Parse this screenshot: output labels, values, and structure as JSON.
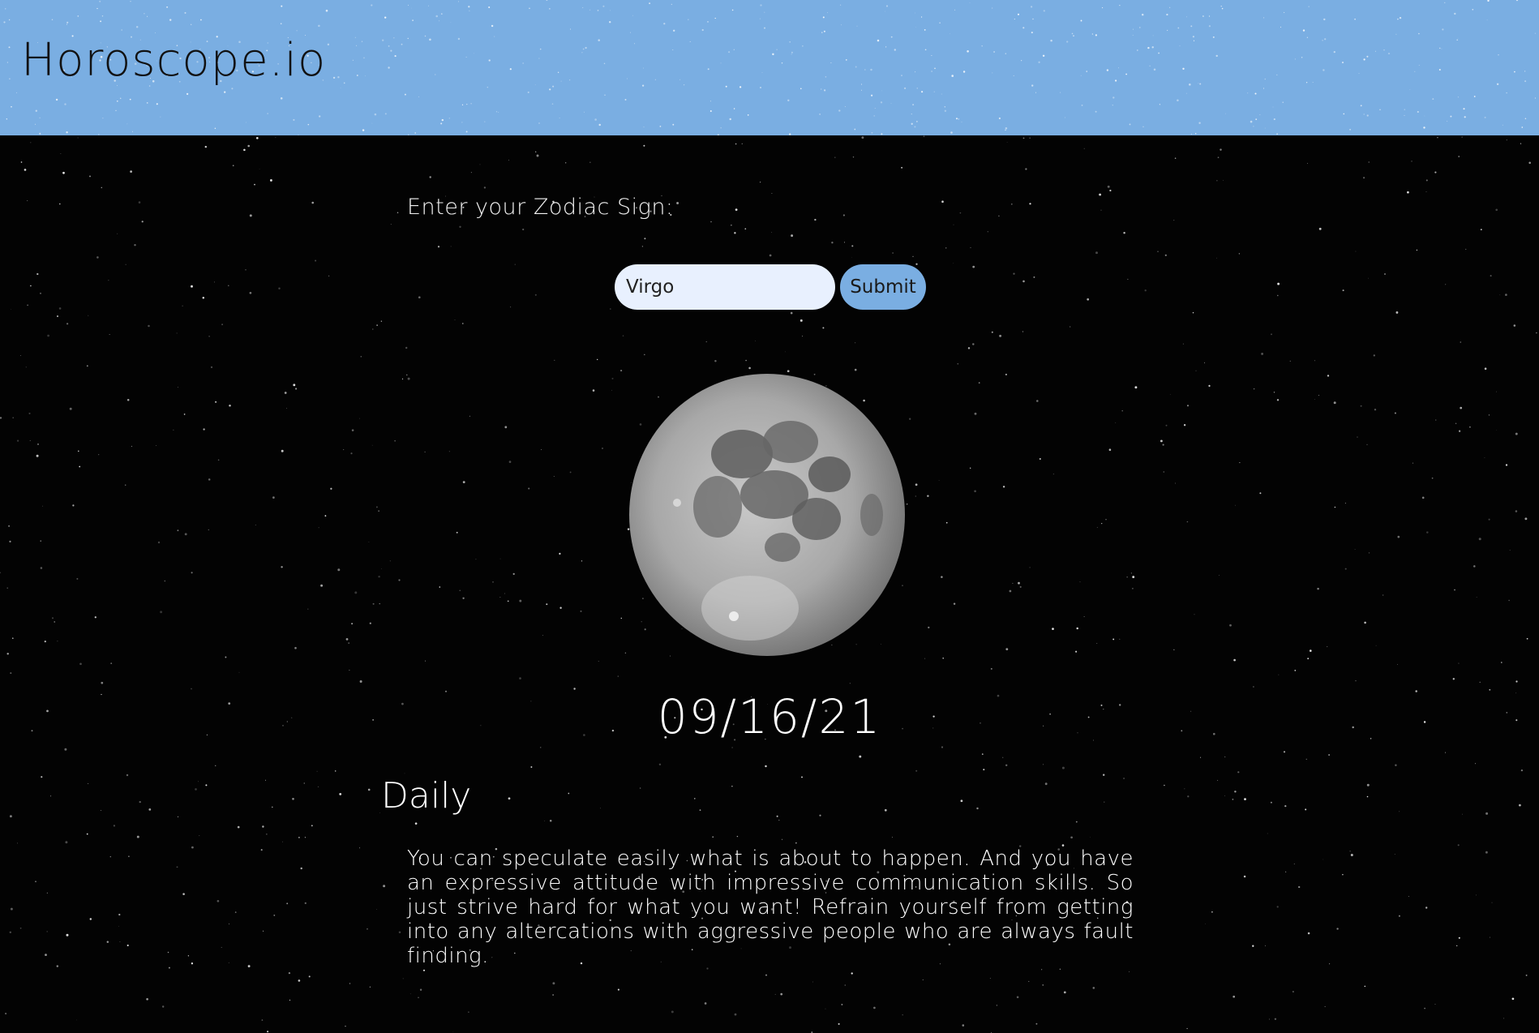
{
  "header": {
    "title": "Horoscope.io"
  },
  "form": {
    "label": "Enter your Zodiac Sign:",
    "input_value": "Virgo",
    "submit_label": "Submit"
  },
  "result": {
    "date": "09/16/21",
    "section_title": "Daily",
    "text": "You can speculate easily what is about to happen. And you have an expressive attitude with impressive communication skills. So just strive hard for what you want! Refrain yourself from getting into any altercations with aggressive people who are always fault finding."
  },
  "colors": {
    "header_bg": "#7aaee2",
    "submit_bg": "#7aaee2",
    "input_bg": "#e8f0fe",
    "page_bg": "#030303"
  }
}
